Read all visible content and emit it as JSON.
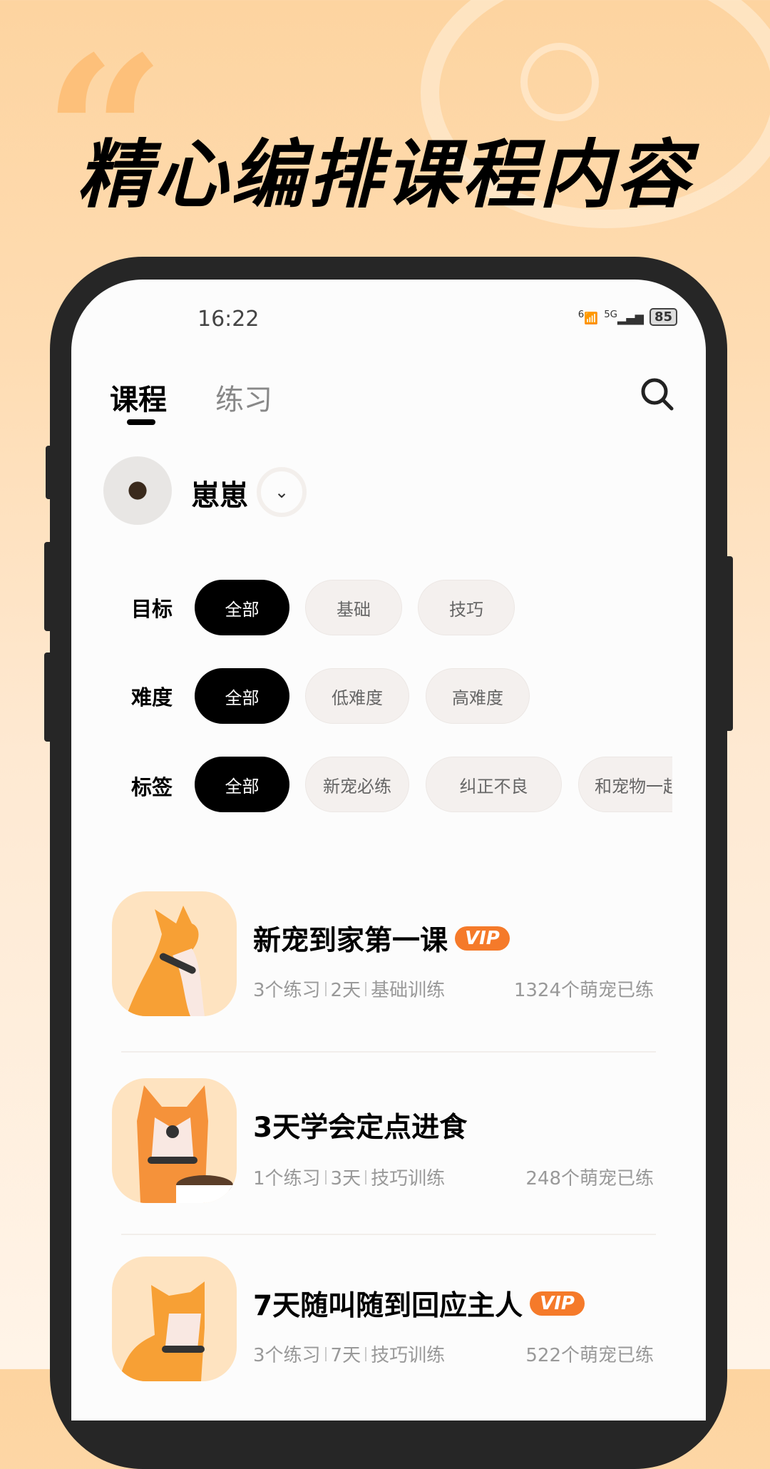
{
  "headline": "精心编排课程内容",
  "status": {
    "time": "16:22",
    "wifi": "6",
    "network": "5G",
    "battery": "85"
  },
  "tabs": [
    {
      "label": "课程",
      "active": true
    },
    {
      "label": "练习",
      "active": false
    }
  ],
  "pet": {
    "name": "崽崽"
  },
  "filters": [
    {
      "label": "目标",
      "options": [
        "全部",
        "基础",
        "技巧"
      ],
      "selected": "全部"
    },
    {
      "label": "难度",
      "options": [
        "全部",
        "低难度",
        "高难度"
      ],
      "selected": "全部"
    },
    {
      "label": "标签",
      "options": [
        "全部",
        "新宠必练",
        "纠正不良",
        "和宠物一起"
      ],
      "selected": "全部"
    }
  ],
  "courses": [
    {
      "title": "新宠到家第一课",
      "vip": "VIP",
      "exercises": "3个练习",
      "days": "2天",
      "type": "基础训练",
      "count": "1324个萌宠已练"
    },
    {
      "title": "3天学会定点进食",
      "vip": "",
      "exercises": "1个练习",
      "days": "3天",
      "type": "技巧训练",
      "count": "248个萌宠已练"
    },
    {
      "title": "7天随叫随到回应主人",
      "vip": "VIP",
      "exercises": "3个练习",
      "days": "7天",
      "type": "技巧训练",
      "count": "522个萌宠已练"
    }
  ],
  "colors": {
    "accent": "#f57a2a",
    "background": "#fdd4a0",
    "frame": "#262626"
  }
}
